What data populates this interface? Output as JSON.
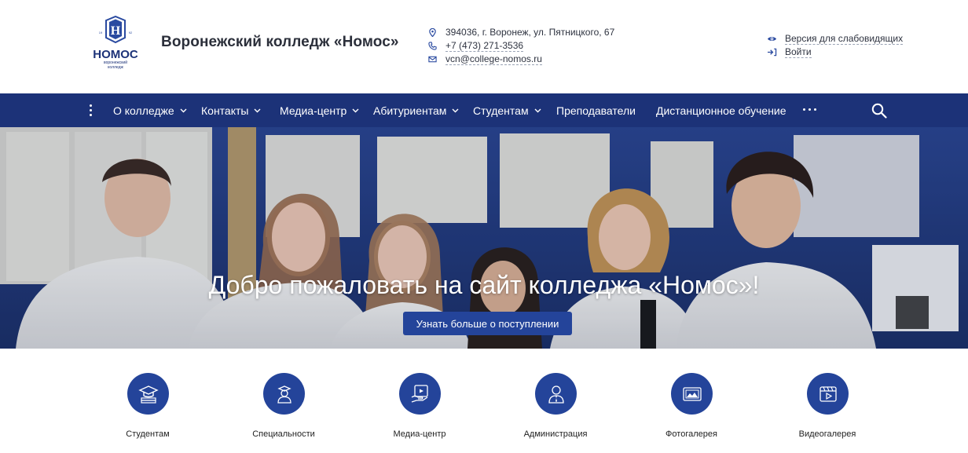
{
  "header": {
    "logo": {
      "letter": "Н",
      "year_left": "19",
      "year_right": "92",
      "name": "НОМОС",
      "subtitle_line1": "воронежский",
      "subtitle_line2": "колледж"
    },
    "site_title": "Воронежский колледж «Номос»",
    "contacts": {
      "address": "394036, г. Воронеж, ул. Пятницкого, 67",
      "phone": "+7 (473) 271-3536",
      "email": "vcn@college-nomos.ru"
    },
    "accessibility": {
      "low_vision_label": "Версия для слабовидящих",
      "login_label": "Войти"
    }
  },
  "nav": {
    "menu_icon": "kebab-menu-icon",
    "items": [
      {
        "label": "О колледже",
        "dropdown": true
      },
      {
        "label": "Контакты",
        "dropdown": true
      },
      {
        "label": "Медиа-центр",
        "dropdown": true
      },
      {
        "label": "Абитуриентам",
        "dropdown": true
      },
      {
        "label": "Студентам",
        "dropdown": true
      },
      {
        "label": "Преподаватели",
        "dropdown": false
      },
      {
        "label": "Дистанционное обучение",
        "dropdown": false
      }
    ],
    "more_icon": "more-horizontal-icon",
    "search_icon": "search-icon"
  },
  "hero": {
    "title": "Добро пожаловать на сайт колледжа «Номос»!",
    "cta_label": "Узнать больше о поступлении"
  },
  "quick_links": [
    {
      "label": "Студентам",
      "icon": "graduation-cap-icon"
    },
    {
      "label": "Специальности",
      "icon": "graduate-person-icon"
    },
    {
      "label": "Медиа-центр",
      "icon": "media-tablet-icon"
    },
    {
      "label": "Администрация",
      "icon": "administrator-icon"
    },
    {
      "label": "Фотогалерея",
      "icon": "photo-gallery-icon"
    },
    {
      "label": "Видеогалерея",
      "icon": "video-gallery-icon"
    }
  ],
  "colors": {
    "brand_navy": "#1c3278",
    "button_blue": "#24449a",
    "text_dark": "#2b2f3a"
  }
}
